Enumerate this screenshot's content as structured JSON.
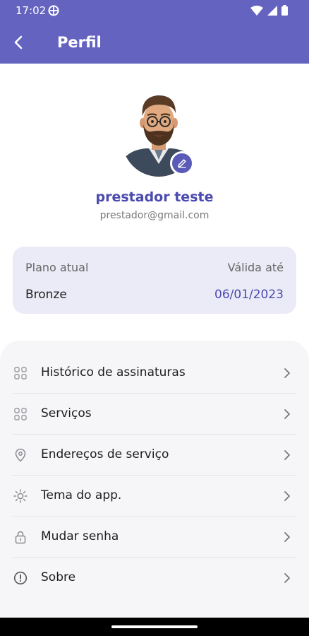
{
  "status_bar": {
    "time": "17:02",
    "icons": [
      "vpn-globe-icon",
      "wifi-icon",
      "signal-icon",
      "battery-icon"
    ]
  },
  "app_bar": {
    "title": "Perfil",
    "back_icon": "arrow-back-icon",
    "color": "#6464c0"
  },
  "profile": {
    "name": "prestador teste",
    "email": "prestador@gmail.com",
    "edit_icon": "pencil-icon",
    "accent": "#4a4ab0"
  },
  "plan": {
    "current_label": "Plano atual",
    "current_value": "Bronze",
    "valid_label": "Válida até",
    "valid_value": "06/01/2023"
  },
  "menu": {
    "items": [
      {
        "label": "Histórico de assinaturas",
        "icon": "grid-icon"
      },
      {
        "label": "Serviços",
        "icon": "grid-icon"
      },
      {
        "label": "Endereços de serviço",
        "icon": "location-pin-icon"
      },
      {
        "label": "Tema do app.",
        "icon": "sun-icon"
      },
      {
        "label": "Mudar senha",
        "icon": "lock-icon"
      },
      {
        "label": "Sobre",
        "icon": "info-icon"
      }
    ]
  }
}
